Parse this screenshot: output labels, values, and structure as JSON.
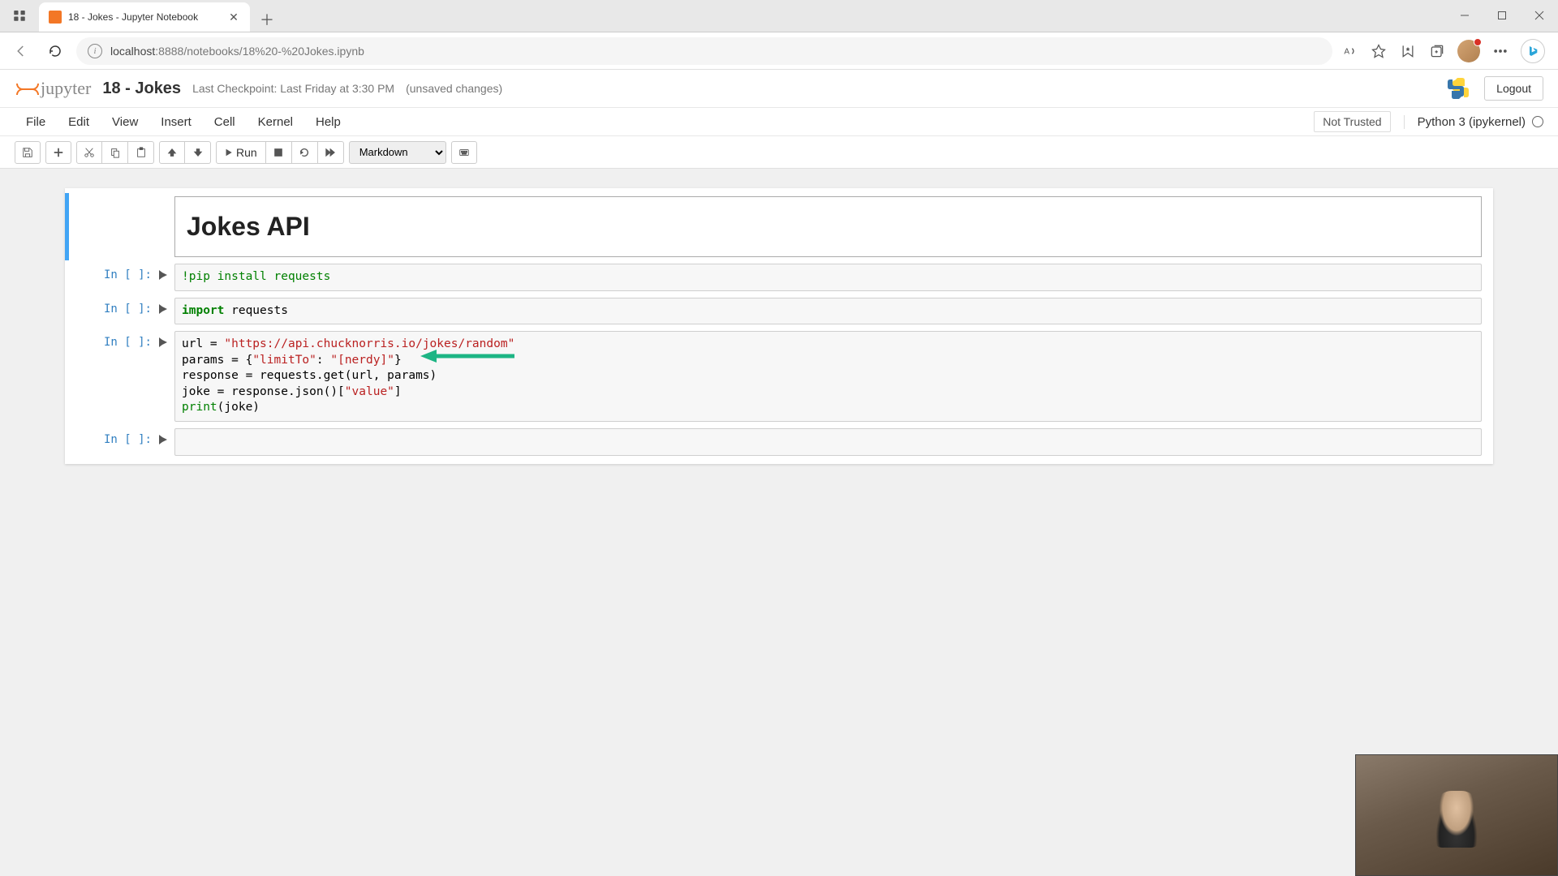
{
  "browser": {
    "tab_title": "18 - Jokes - Jupyter Notebook",
    "url_host": "localhost",
    "url_port": ":8888",
    "url_path": "/notebooks/18%20-%20Jokes.ipynb"
  },
  "header": {
    "logo_text": "jupyter",
    "notebook_name": "18 - Jokes",
    "checkpoint": "Last Checkpoint: Last Friday at 3:30 PM",
    "unsaved": "(unsaved changes)",
    "logout": "Logout"
  },
  "menu": {
    "items": [
      "File",
      "Edit",
      "View",
      "Insert",
      "Cell",
      "Kernel",
      "Help"
    ],
    "trust": "Not Trusted",
    "kernel": "Python 3 (ipykernel)"
  },
  "toolbar": {
    "run_label": "Run",
    "cell_type": "Markdown"
  },
  "cells": {
    "markdown_h1": "Jokes API",
    "prompt_label": "In [ ]:",
    "c1_line1_a": "!pip install requests",
    "c2_kw": "import",
    "c2_rest": " requests",
    "c3_l1_a": "url = ",
    "c3_l1_s": "\"https://api.chucknorris.io/jokes/random\"",
    "c3_l2_a": "params = {",
    "c3_l2_s1": "\"limitTo\"",
    "c3_l2_b": ": ",
    "c3_l2_s2": "\"[nerdy]\"",
    "c3_l2_c": "}",
    "c3_l3": "response = requests.get(url, params)",
    "c3_l4_a": "joke = response.json()[",
    "c3_l4_s": "\"value\"",
    "c3_l4_b": "]",
    "c3_l5_a": "print",
    "c3_l5_b": "(joke)"
  }
}
